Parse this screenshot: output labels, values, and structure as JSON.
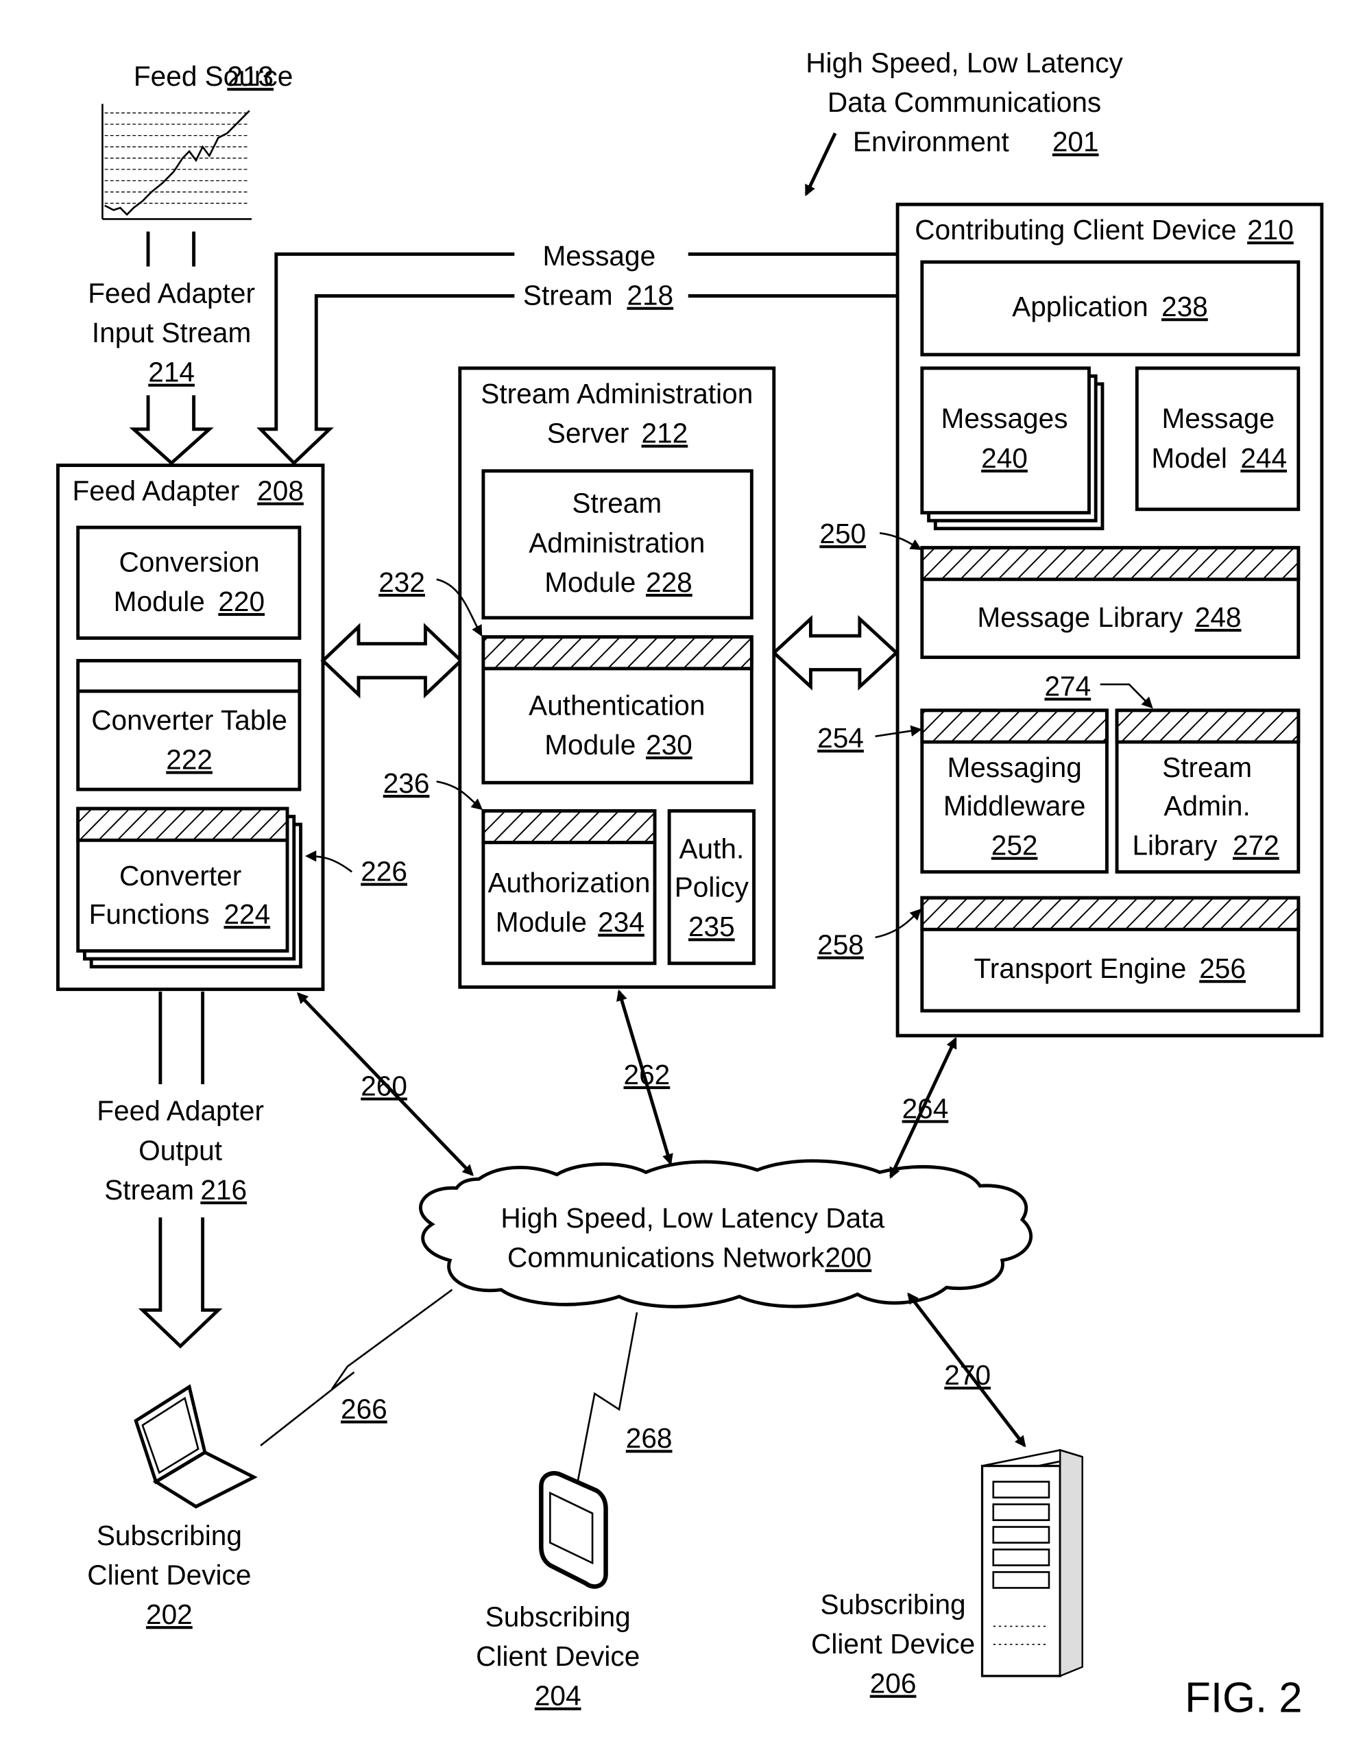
{
  "figure_label": "FIG. 2",
  "environment": {
    "lines": [
      "High Speed, Low Latency",
      "Data Communications",
      "Environment"
    ],
    "ref": "201"
  },
  "feed_source": {
    "label": "Feed Source",
    "ref": "213"
  },
  "feed_input_stream": {
    "lines": [
      "Feed Adapter",
      "Input Stream"
    ],
    "ref": "214"
  },
  "message_stream": {
    "lines": [
      "Message",
      "Stream"
    ],
    "ref": "218"
  },
  "feed_adapter": {
    "title": "Feed Adapter",
    "ref": "208",
    "conversion_module": {
      "lines": [
        "Conversion",
        "Module"
      ],
      "ref": "220"
    },
    "converter_table": {
      "label": "Converter Table",
      "ref": "222"
    },
    "converter_functions": {
      "lines": [
        "Converter",
        "Functions"
      ],
      "ref": "224"
    },
    "callout_226": "226"
  },
  "feed_output_stream": {
    "lines": [
      "Feed Adapter",
      "Output",
      "Stream"
    ],
    "ref": "216"
  },
  "stream_admin_server": {
    "lines": [
      "Stream Administration",
      "Server"
    ],
    "ref": "212",
    "admin_module": {
      "lines": [
        "Stream",
        "Administration",
        "Module"
      ],
      "ref": "228"
    },
    "auth_module": {
      "lines": [
        "Authentication",
        "Module"
      ],
      "ref": "230"
    },
    "authz_module": {
      "lines": [
        "Authorization",
        "Module"
      ],
      "ref": "234"
    },
    "auth_policy": {
      "lines": [
        "Auth.",
        "Policy"
      ],
      "ref": "235"
    },
    "callout_232": "232",
    "callout_236": "236"
  },
  "contributing_client": {
    "title": "Contributing Client Device",
    "ref": "210",
    "application": {
      "label": "Application",
      "ref": "238"
    },
    "messages": {
      "label": "Messages",
      "ref": "240"
    },
    "message_model": {
      "lines": [
        "Message",
        "Model"
      ],
      "ref": "244"
    },
    "message_library": {
      "label": "Message Library",
      "ref": "248"
    },
    "messaging_middleware": {
      "lines": [
        "Messaging",
        "Middleware"
      ],
      "ref": "252"
    },
    "stream_admin_library": {
      "lines": [
        "Stream",
        "Admin.",
        "Library"
      ],
      "ref": "272"
    },
    "transport_engine": {
      "label": "Transport Engine",
      "ref": "256"
    },
    "callouts": {
      "c250": "250",
      "c254": "254",
      "c258": "258",
      "c274": "274"
    }
  },
  "network": {
    "lines": [
      "High Speed, Low Latency Data",
      "Communications Network"
    ],
    "ref": "200"
  },
  "links": {
    "l260": "260",
    "l262": "262",
    "l264": "264",
    "l266": "266",
    "l268": "268",
    "l270": "270"
  },
  "subscriber_202": {
    "lines": [
      "Subscribing",
      "Client Device"
    ],
    "ref": "202",
    "icon": "laptop-icon"
  },
  "subscriber_204": {
    "lines": [
      "Subscribing",
      "Client Device"
    ],
    "ref": "204",
    "icon": "handheld-icon"
  },
  "subscriber_206": {
    "lines": [
      "Subscribing",
      "Client Device"
    ],
    "ref": "206",
    "icon": "server-tower-icon"
  }
}
